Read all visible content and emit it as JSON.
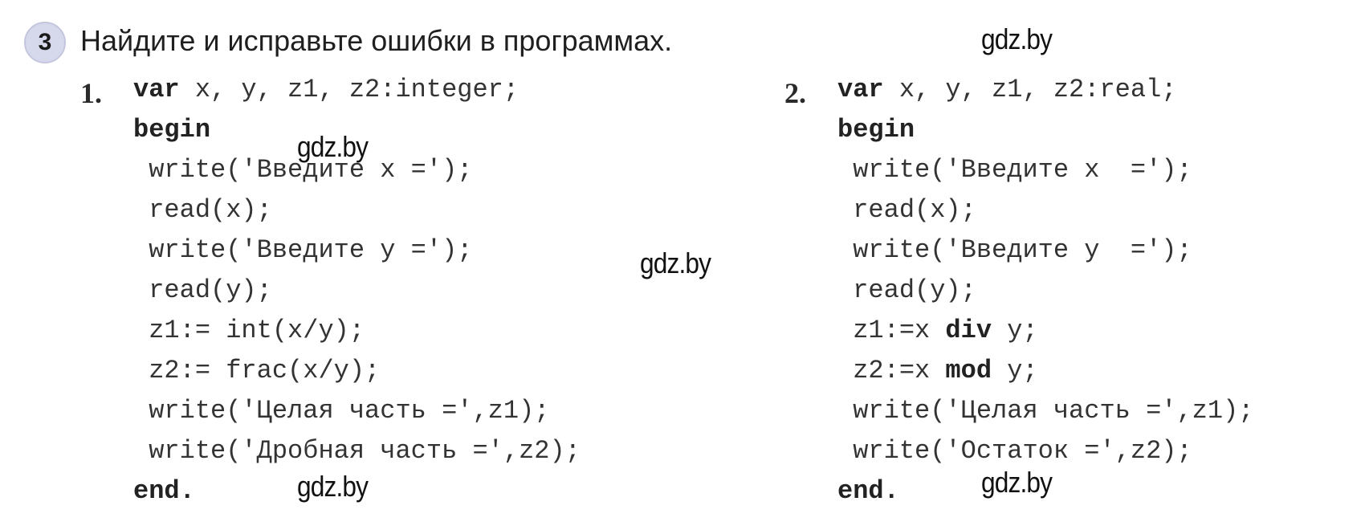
{
  "task": {
    "number": "3",
    "text": "Найдите и исправьте ошибки в программах."
  },
  "watermarks": [
    "gdz.by",
    "gdz.by",
    "gdz.by",
    "gdz.by",
    "gdz.by"
  ],
  "programs": [
    {
      "label": "1.",
      "lines": [
        [
          {
            "t": "var",
            "kw": true
          },
          {
            "t": " x, y, z1, z2:integer;"
          }
        ],
        [
          {
            "t": "begin",
            "kw": true
          }
        ],
        [
          {
            "t": " write('Введите x =');"
          }
        ],
        [
          {
            "t": " read(x);"
          }
        ],
        [
          {
            "t": " write('Введите y =');"
          }
        ],
        [
          {
            "t": " read(y);"
          }
        ],
        [
          {
            "t": " z1:= int(x/y);"
          }
        ],
        [
          {
            "t": " z2:= frac(x/y);"
          }
        ],
        [
          {
            "t": " write('Целая часть =',z1);"
          }
        ],
        [
          {
            "t": " write('Дробная часть =',z2);"
          }
        ],
        [
          {
            "t": "end.",
            "kw": true
          }
        ]
      ]
    },
    {
      "label": "2.",
      "lines": [
        [
          {
            "t": "var",
            "kw": true
          },
          {
            "t": " x, y, z1, z2:real;"
          }
        ],
        [
          {
            "t": "begin",
            "kw": true
          }
        ],
        [
          {
            "t": " write('Введите x  =');"
          }
        ],
        [
          {
            "t": " read(x);"
          }
        ],
        [
          {
            "t": " write('Введите y  =');"
          }
        ],
        [
          {
            "t": " read(y);"
          }
        ],
        [
          {
            "t": " z1:=x "
          },
          {
            "t": "div",
            "kw": true
          },
          {
            "t": " y;"
          }
        ],
        [
          {
            "t": " z2:=x "
          },
          {
            "t": "mod",
            "kw": true
          },
          {
            "t": " y;"
          }
        ],
        [
          {
            "t": " write('Целая часть =',z1);"
          }
        ],
        [
          {
            "t": " write('Остаток =',z2);"
          }
        ],
        [
          {
            "t": "end.",
            "kw": true
          }
        ]
      ]
    }
  ]
}
